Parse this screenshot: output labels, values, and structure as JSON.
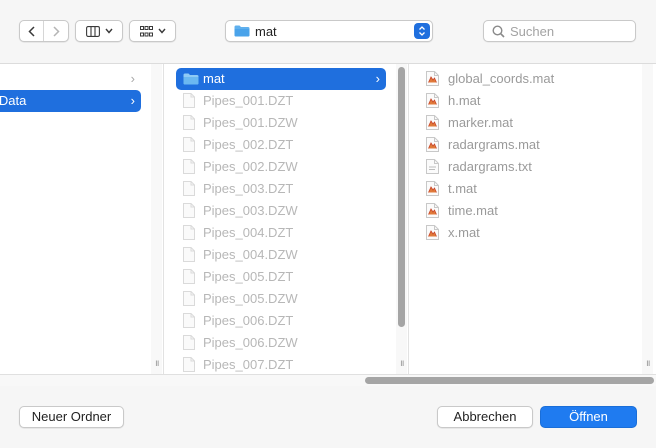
{
  "toolbar": {
    "back_icon": "chevron-left-icon",
    "forward_icon": "chevron-right-icon",
    "view_icon": "column-view-icon",
    "group_icon": "grid-group-icon",
    "path": {
      "label": "mat",
      "icon": "folder-icon"
    },
    "search": {
      "placeholder": "Suchen"
    }
  },
  "columns": {
    "first": {
      "items": [
        {
          "label": "",
          "state": "normal",
          "has_chevron": true
        },
        {
          "label": "lData",
          "state": "selected-inactive",
          "has_chevron": true
        }
      ]
    },
    "second": {
      "items": [
        {
          "label": "mat",
          "icon": "folder-icon",
          "state": "selected",
          "has_chevron": true
        },
        {
          "label": "Pipes_001.DZT",
          "state": "disabled"
        },
        {
          "label": "Pipes_001.DZW",
          "state": "disabled"
        },
        {
          "label": "Pipes_002.DZT",
          "state": "disabled"
        },
        {
          "label": "Pipes_002.DZW",
          "state": "disabled"
        },
        {
          "label": "Pipes_003.DZT",
          "state": "disabled"
        },
        {
          "label": "Pipes_003.DZW",
          "state": "disabled"
        },
        {
          "label": "Pipes_004.DZT",
          "state": "disabled"
        },
        {
          "label": "Pipes_004.DZW",
          "state": "disabled"
        },
        {
          "label": "Pipes_005.DZT",
          "state": "disabled"
        },
        {
          "label": "Pipes_005.DZW",
          "state": "disabled"
        },
        {
          "label": "Pipes_006.DZT",
          "state": "disabled"
        },
        {
          "label": "Pipes_006.DZW",
          "state": "disabled"
        },
        {
          "label": "Pipes_007.DZT",
          "state": "disabled"
        }
      ]
    },
    "third": {
      "items": [
        {
          "label": "global_coords.mat",
          "icon": "mat-file-icon"
        },
        {
          "label": "h.mat",
          "icon": "mat-file-icon"
        },
        {
          "label": "marker.mat",
          "icon": "mat-file-icon"
        },
        {
          "label": "radargrams.mat",
          "icon": "mat-file-icon"
        },
        {
          "label": "radargrams.txt",
          "icon": "text-file-icon"
        },
        {
          "label": "t.mat",
          "icon": "mat-file-icon"
        },
        {
          "label": "time.mat",
          "icon": "mat-file-icon"
        },
        {
          "label": "x.mat",
          "icon": "mat-file-icon"
        }
      ]
    }
  },
  "footer": {
    "new_folder_label": "Neuer Ordner",
    "cancel_label": "Abbrechen",
    "open_label": "Öffnen"
  },
  "colors": {
    "accent": "#1f6fde",
    "primary_button": "#1f7bf0",
    "disabled_text": "#b7b7b7"
  }
}
